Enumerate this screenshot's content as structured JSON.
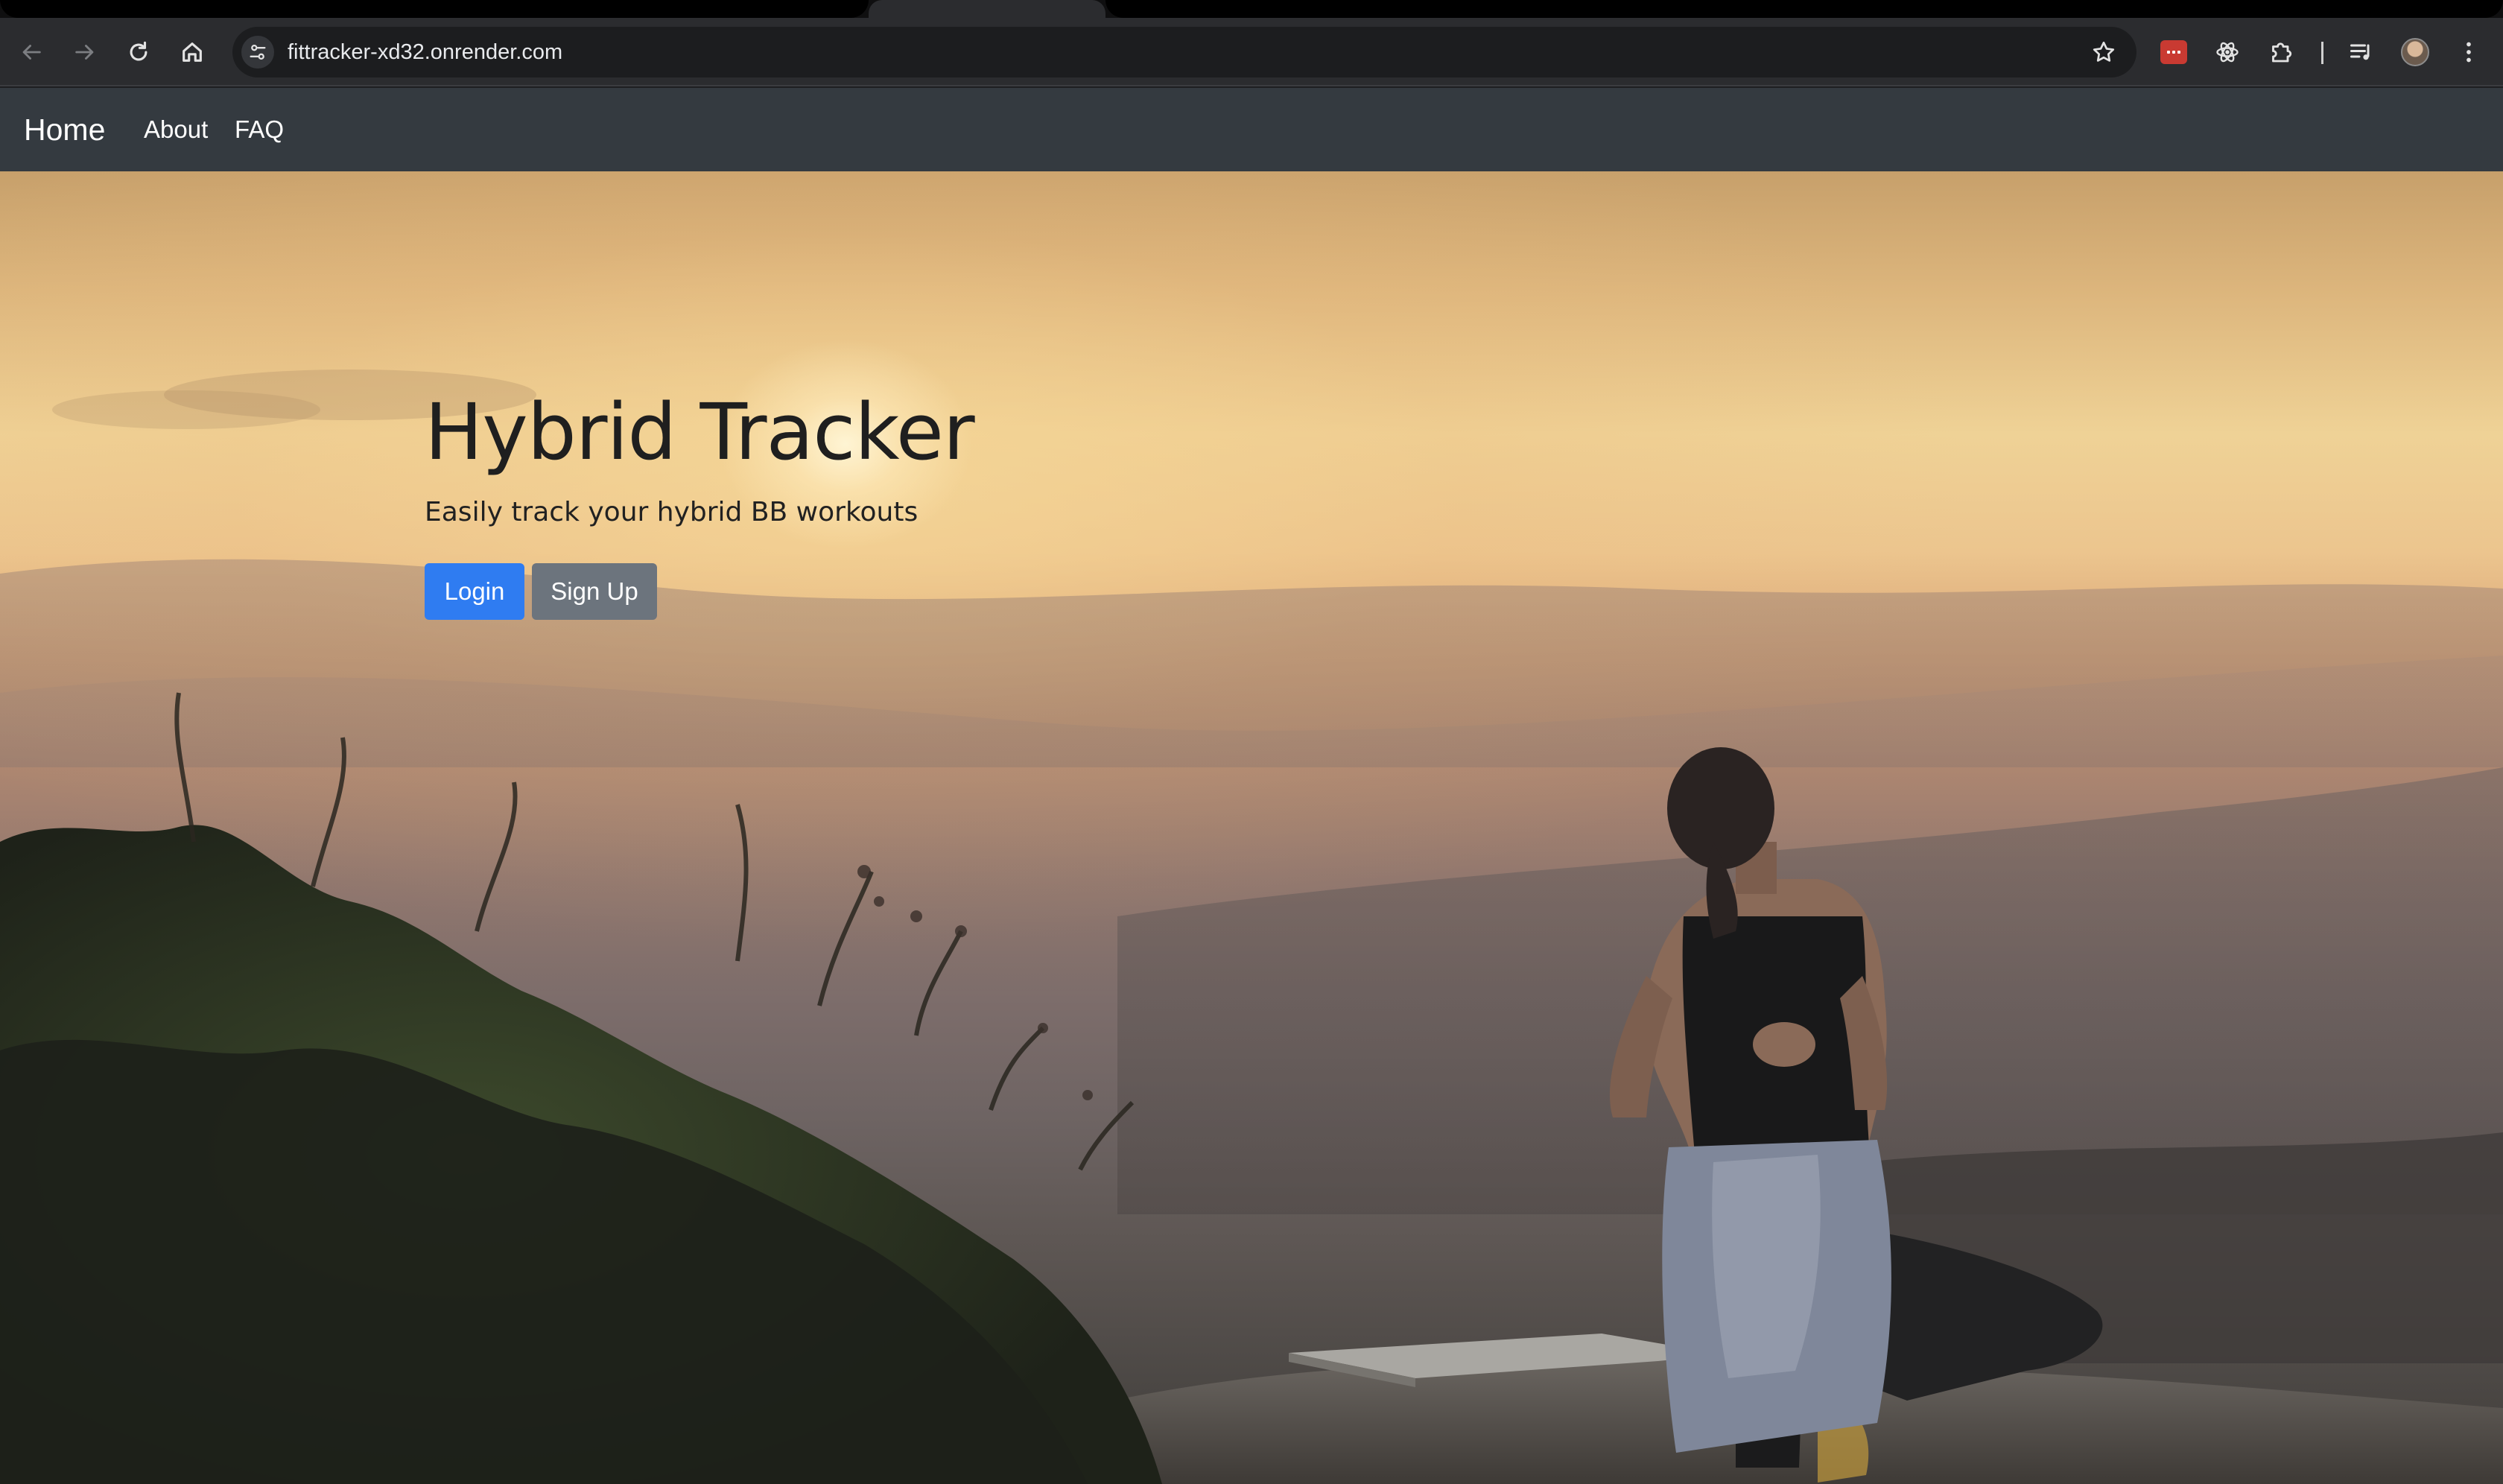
{
  "browser": {
    "url": "fittracker-xd32.onrender.com",
    "icons": {
      "back": "arrow-left-icon",
      "forward": "arrow-right-icon",
      "reload": "reload-icon",
      "home": "home-icon",
      "site_settings": "tune-icon",
      "bookmark": "star-icon",
      "extensions": [
        "password-manager-icon",
        "react-atom-icon",
        "puzzle-icon"
      ],
      "media": "media-queue-icon",
      "profile": "avatar",
      "menu": "kebab-menu-icon"
    }
  },
  "navbar": {
    "brand": "Home",
    "links": [
      "About",
      "FAQ"
    ],
    "background": "#343a40"
  },
  "hero": {
    "title": "Hybrid Tracker",
    "subtitle": "Easily track your hybrid BB workouts",
    "buttons": {
      "login": "Login",
      "signup": "Sign Up"
    },
    "colors": {
      "login": "#2f7cf1",
      "signup": "#6c747d"
    }
  }
}
